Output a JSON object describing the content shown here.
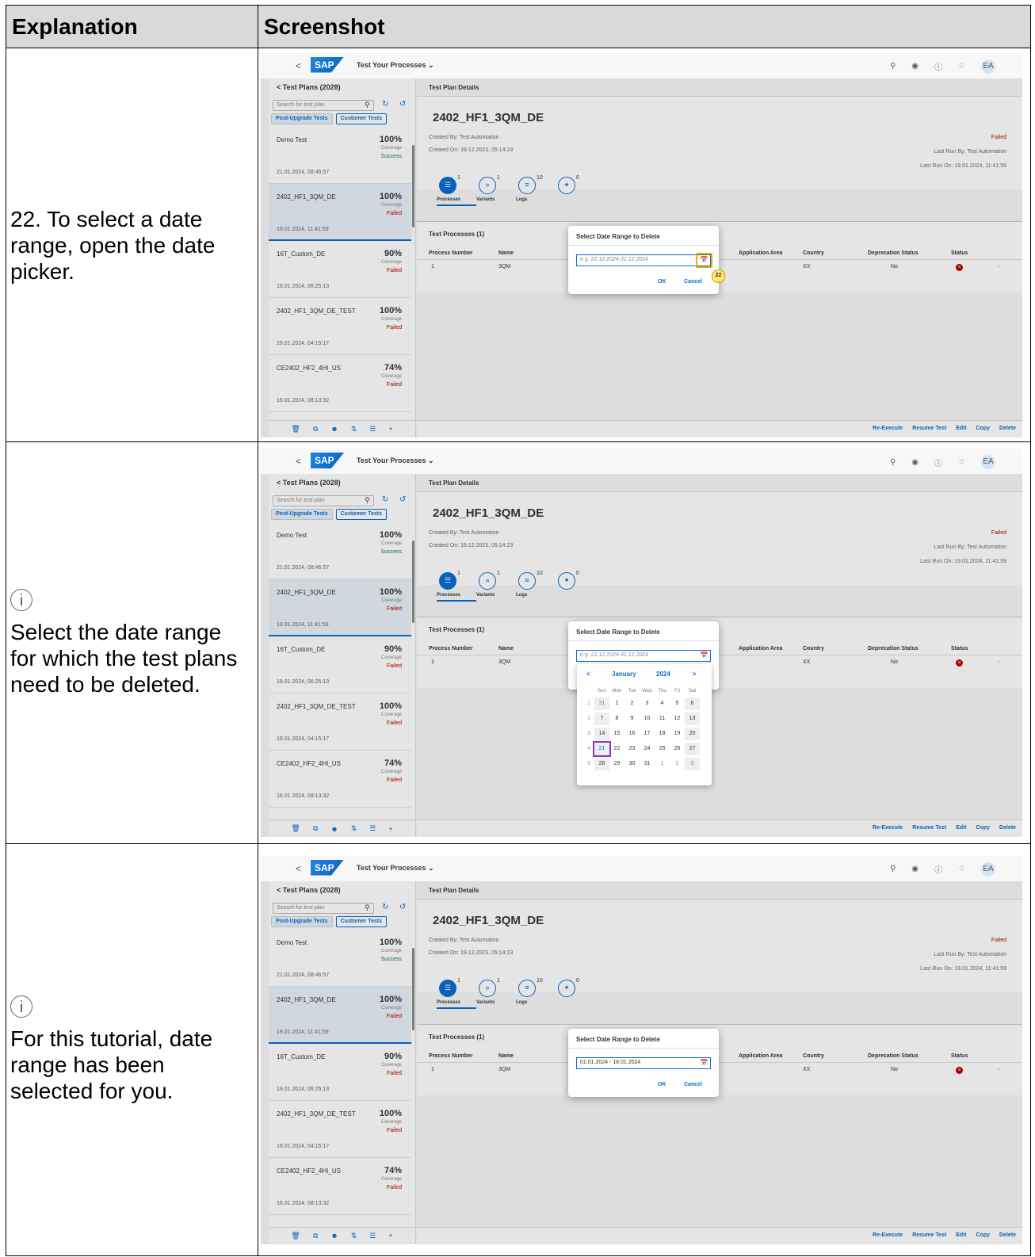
{
  "table": {
    "header_explanation": "Explanation",
    "header_screenshot": "Screenshot"
  },
  "rows": [
    {
      "text": "22. To select a date range, open the date picker."
    },
    {
      "text": "Select the date range for which the test plans need to be deleted."
    },
    {
      "text": "For this tutorial, date range has been selected for you."
    }
  ],
  "app": {
    "logo": "SAP",
    "title": "Test Your Processes ⌄",
    "back": "<",
    "avatar": "EA",
    "left_title": "<  Test Plans (2028)",
    "search_placeholder": "Search for test plan",
    "seg_post": "Post-Upgrade Tests",
    "seg_customer": "Customer Tests",
    "plans": [
      {
        "name": "Demo Test",
        "pct": "100%",
        "cov": "Coverage",
        "status": "Success",
        "date": "21.01.2024, 08:46:57"
      },
      {
        "name": "2402_HF1_3QM_DE",
        "pct": "100%",
        "cov": "Coverage",
        "status": "Failed",
        "date": "19.01.2024, 11:41:59"
      },
      {
        "name": "16T_Custom_DE",
        "pct": "90%",
        "cov": "Coverage",
        "status": "Failed",
        "date": "19.01.2024, 06:25:13"
      },
      {
        "name": "2402_HF1_3QM_DE_TEST",
        "pct": "100%",
        "cov": "Coverage",
        "status": "Failed",
        "date": "19.01.2024, 04:15:17"
      },
      {
        "name": "CE2402_HF2_4HI_US",
        "pct": "74%",
        "cov": "Coverage",
        "status": "Failed",
        "date": "16.01.2024, 08:13:32"
      }
    ],
    "details_title": "Test Plan Details",
    "object_title": "2402_HF1_3QM_DE",
    "created_by": "Created By: Test Automation",
    "created_on": "Created On: 19.12.2023, 05:14:23",
    "status": "Failed",
    "last_run_by": "Last Run By: Test Automation",
    "last_run_on": "Last Run On: 19.01.2024, 11:41:59",
    "tabs": [
      {
        "label": "Processes",
        "count": "1"
      },
      {
        "label": "Variants",
        "count": "1"
      },
      {
        "label": "Logs",
        "count": "10"
      },
      {
        "label": "",
        "count": "0"
      }
    ],
    "processes_title": "Test Processes (1)",
    "columns": [
      "Process Number",
      "Name",
      "Application Area",
      "Country",
      "Deprecation Status",
      "Status"
    ],
    "row": {
      "number": "1",
      "name": "3QM",
      "country": "XX",
      "deprecation": "No"
    },
    "actions": [
      "Re-Execute",
      "Resume Test",
      "Edit",
      "Copy",
      "Delete"
    ],
    "dialog_title": "Select Date Range to Delete",
    "date_placeholder": "e.g. 22.12.2024-31.12.2024",
    "date_value": "01.01.2024 - 18.01.2024",
    "ok": "OK",
    "cancel": "Cancel",
    "callout": "22"
  },
  "calendar": {
    "month": "January",
    "year": "2024",
    "prev": "<",
    "next": ">",
    "weekdays": [
      "Sun",
      "Mon",
      "Tue",
      "Wed",
      "Thu",
      "Fri",
      "Sat"
    ],
    "weeks": [
      {
        "wk": "1",
        "days": [
          "31",
          "1",
          "2",
          "3",
          "4",
          "5",
          "6"
        ]
      },
      {
        "wk": "2",
        "days": [
          "7",
          "8",
          "9",
          "10",
          "11",
          "12",
          "13"
        ]
      },
      {
        "wk": "3",
        "days": [
          "14",
          "15",
          "16",
          "17",
          "18",
          "19",
          "20"
        ]
      },
      {
        "wk": "4",
        "days": [
          "21",
          "22",
          "23",
          "24",
          "25",
          "26",
          "27"
        ]
      },
      {
        "wk": "5",
        "days": [
          "28",
          "29",
          "30",
          "31",
          "1",
          "2",
          "3"
        ]
      }
    ]
  },
  "colors": {
    "accent": "#0a6ed1",
    "error": "#bb0000",
    "success": "#107e3e",
    "callout": "#ffe874"
  }
}
